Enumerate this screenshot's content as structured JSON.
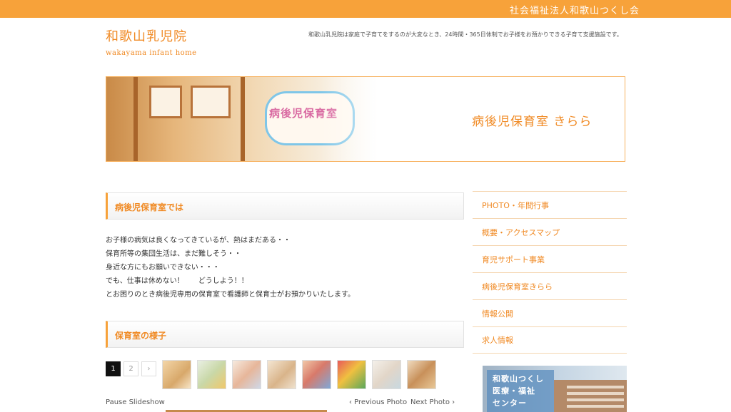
{
  "topbar": {
    "org_name": "社会福祉法人和歌山つくし会"
  },
  "logo": {
    "name_jp": "和歌山乳児院",
    "name_en": "wakayama infant home"
  },
  "header": {
    "tagline": "和歌山乳児院は家庭で子育てをするのが大変なとき、24時間・365日体制でお子様をお預かりできる子育て支援施設です。"
  },
  "banner": {
    "title": "病後児保育室 きらら",
    "sign_text": "病後児保育室"
  },
  "section1": {
    "heading": "病後児保育室では",
    "lines": [
      "お子様の病気は良くなってきているが、熱はまだある・・",
      "保育所等の集団生活は、まだ難しそう・・",
      "身近な方にもお願いできない・・・",
      "でも、仕事は休めない！　　どうしよう！！",
      "とお困りのとき病後児専用の保育室で看護師と保育士がお預かりいたします。"
    ]
  },
  "section2": {
    "heading": "保育室の様子"
  },
  "pager": {
    "pages": [
      "1",
      "2",
      "›"
    ]
  },
  "slideshow": {
    "pause": "Pause Slideshow",
    "prev": "‹ Previous Photo",
    "next": "Next Photo ›"
  },
  "sidebar": {
    "items": [
      "PHOTO・年間行事",
      "概要・アクセスマップ",
      "育児サポート事業",
      "病後児保育室きらら",
      "情報公開",
      "求人情報"
    ],
    "banner_lines": [
      "和歌山つくし",
      "医療・福祉",
      "センター"
    ]
  },
  "colors": {
    "accent": "#f7a23a",
    "accent_text": "#f08a24"
  }
}
